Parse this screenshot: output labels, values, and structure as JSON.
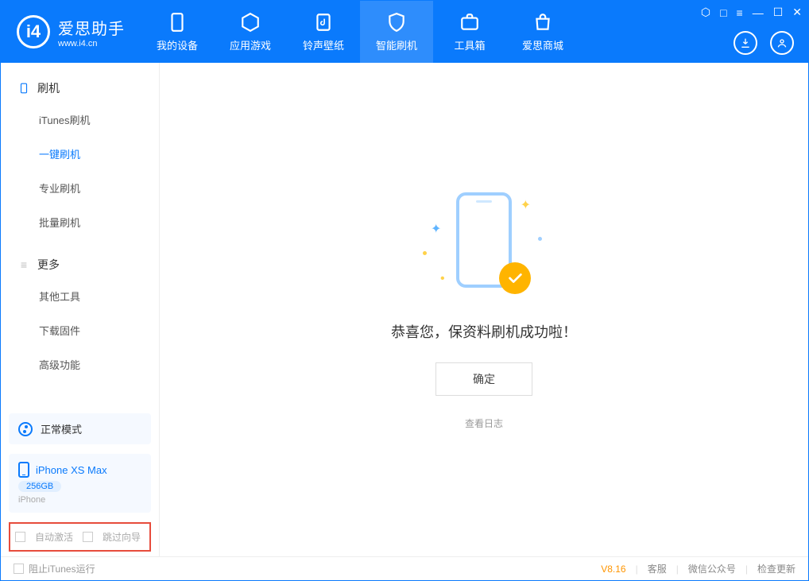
{
  "app": {
    "name": "爱思助手",
    "site": "www.i4.cn"
  },
  "tabs": {
    "device": "我的设备",
    "apps": "应用游戏",
    "ringtone": "铃声壁纸",
    "flash": "智能刷机",
    "toolbox": "工具箱",
    "store": "爱思商城"
  },
  "sidebar": {
    "group1": "刷机",
    "items1": {
      "itunes": "iTunes刷机",
      "oneclick": "一键刷机",
      "pro": "专业刷机",
      "batch": "批量刷机"
    },
    "group2": "更多",
    "items2": {
      "other": "其他工具",
      "firmware": "下载固件",
      "advanced": "高级功能"
    },
    "mode": "正常模式",
    "device_name": "iPhone XS Max",
    "device_capacity": "256GB",
    "device_type": "iPhone",
    "opts": {
      "auto_activate": "自动激活",
      "skip_guide": "跳过向导"
    }
  },
  "main": {
    "success": "恭喜您，保资料刷机成功啦！",
    "ok": "确定",
    "log": "查看日志"
  },
  "status": {
    "block_itunes": "阻止iTunes运行",
    "version": "V8.16",
    "cs": "客服",
    "wechat": "微信公众号",
    "update": "检查更新"
  }
}
